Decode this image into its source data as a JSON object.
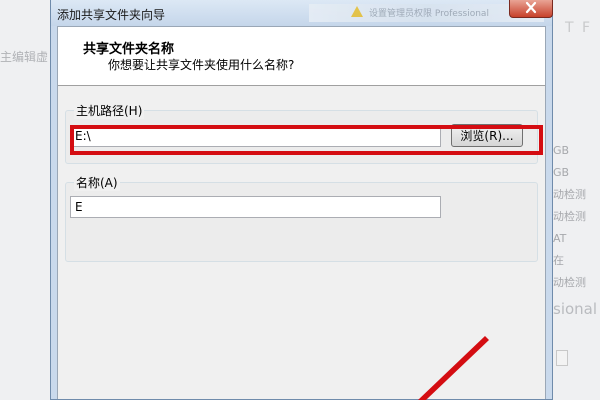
{
  "background": {
    "left_text": "主编辑虚",
    "top_right": "T F",
    "right_column": [
      "GB",
      "GB",
      "动检测",
      "动检测",
      "AT",
      "在",
      "动检测"
    ],
    "edition_text": "sional"
  },
  "window": {
    "title": "添加共享文件夹向导",
    "title_ghost": "设置管理员权限 Professional"
  },
  "header": {
    "title": "共享文件夹名称",
    "subtitle": "你想要让共享文件夹使用什么名称?"
  },
  "host_path": {
    "label": "主机路径(H)",
    "value": "E:\\",
    "browse_label": "浏览(R)..."
  },
  "share_name": {
    "label": "名称(A)",
    "value": "E"
  },
  "colors": {
    "highlight": "#d40d12",
    "title_bar": "#c9d9ec",
    "close_button": "#c7412b"
  },
  "icons": [
    "close-icon",
    "warning-icon",
    "annotation-arrow"
  ]
}
